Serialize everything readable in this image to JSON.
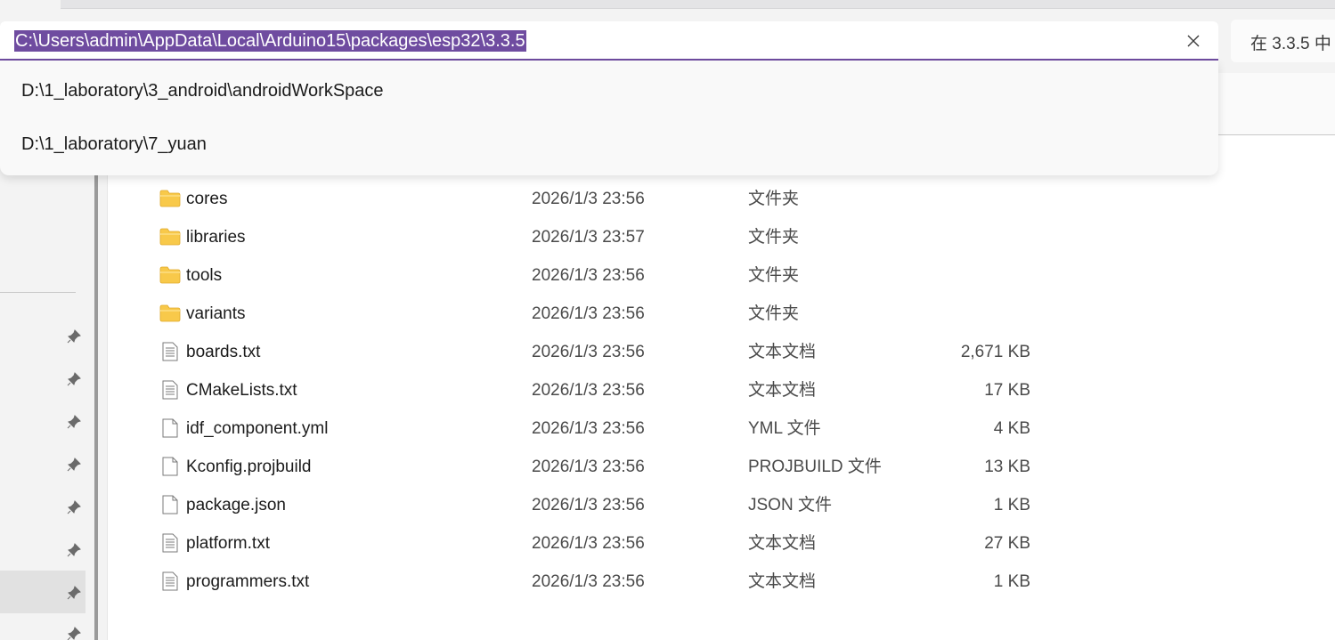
{
  "address_bar": {
    "path": "C:\\Users\\admin\\AppData\\Local\\Arduino15\\packages\\esp32\\3.3.5",
    "clear_icon": "close-icon"
  },
  "search_box": {
    "placeholder": "在 3.3.5 中"
  },
  "suggestions": [
    {
      "path": "D:\\1_laboratory\\3_android\\androidWorkSpace"
    },
    {
      "path": "D:\\1_laboratory\\7_yuan"
    }
  ],
  "files": [
    {
      "name": "cores",
      "date": "2026/1/3 23:56",
      "type": "文件夹",
      "size": "",
      "icon": "folder-icon"
    },
    {
      "name": "libraries",
      "date": "2026/1/3 23:57",
      "type": "文件夹",
      "size": "",
      "icon": "folder-icon"
    },
    {
      "name": "tools",
      "date": "2026/1/3 23:56",
      "type": "文件夹",
      "size": "",
      "icon": "folder-icon"
    },
    {
      "name": "variants",
      "date": "2026/1/3 23:56",
      "type": "文件夹",
      "size": "",
      "icon": "folder-icon"
    },
    {
      "name": "boards.txt",
      "date": "2026/1/3 23:56",
      "type": "文本文档",
      "size": "2,671 KB",
      "icon": "text-file-icon"
    },
    {
      "name": "CMakeLists.txt",
      "date": "2026/1/3 23:56",
      "type": "文本文档",
      "size": "17 KB",
      "icon": "text-file-icon"
    },
    {
      "name": "idf_component.yml",
      "date": "2026/1/3 23:56",
      "type": "YML 文件",
      "size": "4 KB",
      "icon": "file-icon"
    },
    {
      "name": "Kconfig.projbuild",
      "date": "2026/1/3 23:56",
      "type": "PROJBUILD 文件",
      "size": "13 KB",
      "icon": "file-icon"
    },
    {
      "name": "package.json",
      "date": "2026/1/3 23:56",
      "type": "JSON 文件",
      "size": "1 KB",
      "icon": "file-icon"
    },
    {
      "name": "platform.txt",
      "date": "2026/1/3 23:56",
      "type": "文本文档",
      "size": "27 KB",
      "icon": "text-file-icon"
    },
    {
      "name": "programmers.txt",
      "date": "2026/1/3 23:56",
      "type": "文本文档",
      "size": "1 KB",
      "icon": "text-file-icon"
    }
  ],
  "colors": {
    "selection": "#6f4ca0",
    "folder": "#f8c94a",
    "background": "#f3f3f3"
  }
}
